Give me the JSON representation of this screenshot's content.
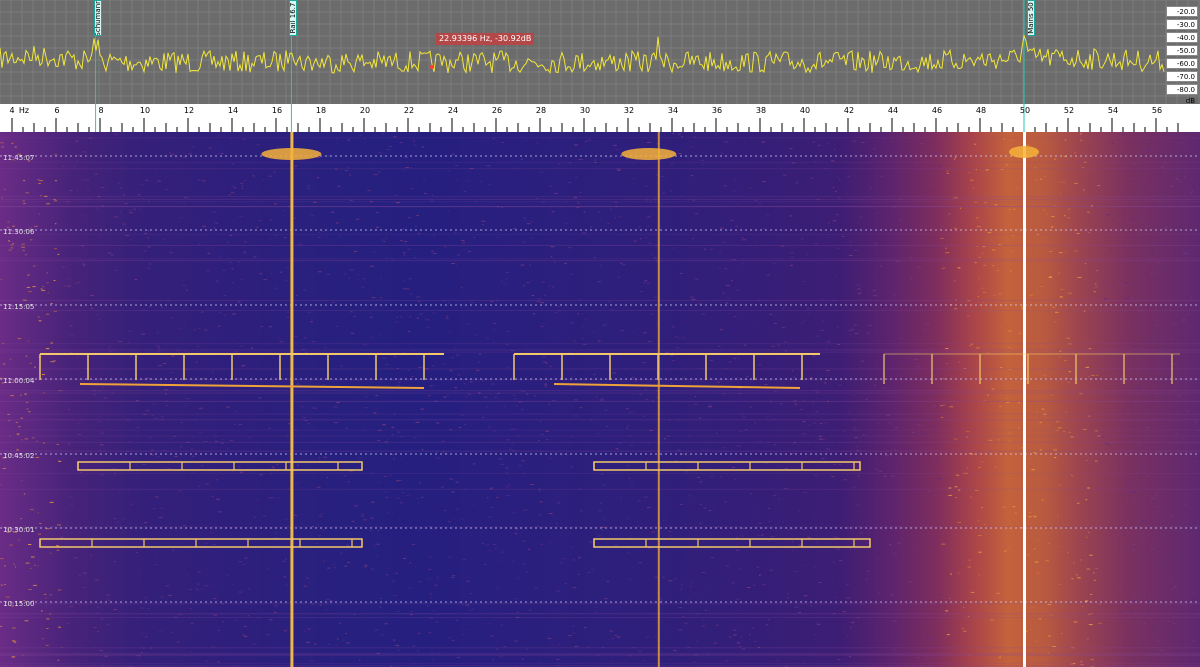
{
  "spectrum": {
    "cursor_readout": "22.93396 Hz, -30.92dB",
    "db_labels": [
      "-20.0 dB",
      "-30.0 dB",
      "-40.0 dB",
      "-50.0 dB",
      "-60.0 dB",
      "-70.0 dB",
      "-80.0 dB"
    ],
    "trace_color": "#f2e73a",
    "background_color": "#6c6c6c"
  },
  "markers": [
    {
      "label": "Schumann",
      "freq": 7.8
    },
    {
      "label": "Rail 16.7",
      "freq": 16.7
    },
    {
      "label": "Mains 50",
      "freq": 50
    }
  ],
  "freq_axis": {
    "unit": "Hz",
    "labels": [
      "4",
      "6",
      "8",
      "10",
      "12",
      "14",
      "16",
      "18",
      "20",
      "22",
      "24",
      "26",
      "28",
      "30",
      "32",
      "34",
      "36",
      "38",
      "40",
      "42",
      "44",
      "46",
      "48",
      "50",
      "52",
      "54",
      "56"
    ]
  },
  "waterfall": {
    "time_labels": [
      "11:45:07",
      "11:30:06",
      "11:15:05",
      "11:00:04",
      "10:45:02",
      "10:30:01",
      "10:15:00"
    ],
    "palette": [
      "#2a1f7e",
      "#6a2c86",
      "#c4623c",
      "#f6b23a",
      "#ffffff"
    ]
  }
}
